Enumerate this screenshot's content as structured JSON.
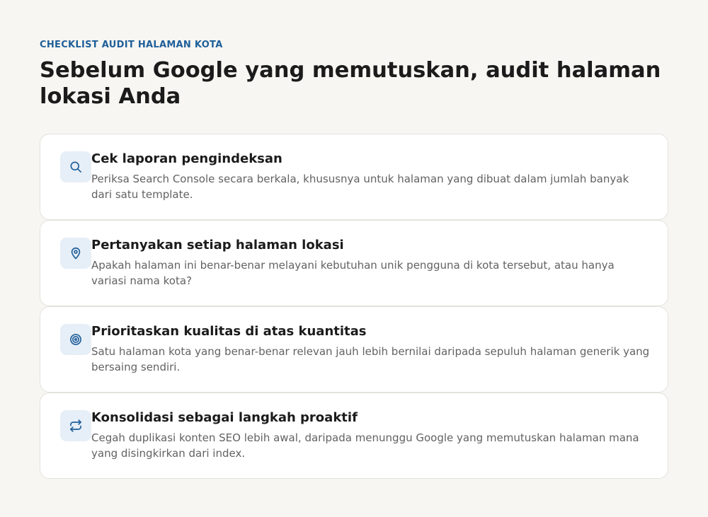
{
  "eyebrow": "CHECKLIST AUDIT HALAMAN KOTA",
  "title": "Sebelum Google yang memutuskan, audit halaman lokasi Anda",
  "accent_color": "#1f5f99",
  "items": [
    {
      "icon": "search-icon",
      "title": "Cek laporan pengindeksan",
      "description": "Periksa Search Console secara berkala, khususnya untuk halaman yang dibuat dalam jumlah banyak dari satu template."
    },
    {
      "icon": "map-pin-icon",
      "title": "Pertanyakan setiap halaman lokasi",
      "description": "Apakah halaman ini benar-benar melayani kebutuhan unik pengguna di kota tersebut, atau hanya variasi nama kota?"
    },
    {
      "icon": "target-icon",
      "title": "Prioritaskan kualitas di atas kuantitas",
      "description": "Satu halaman kota yang benar-benar relevan jauh lebih bernilai daripada sepuluh halaman generik yang bersaing sendiri."
    },
    {
      "icon": "repeat-arrows-icon",
      "title": "Konsolidasi sebagai langkah proaktif",
      "description": "Cegah duplikasi konten SEO lebih awal, daripada menunggu Google yang memutuskan halaman mana yang disingkirkan dari index."
    }
  ]
}
